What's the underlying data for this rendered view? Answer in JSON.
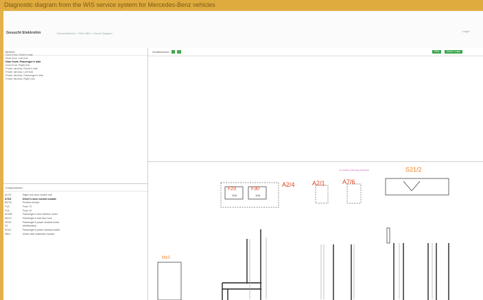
{
  "caption": "Diagnostic diagram from the WIS service system for Mercedes-Benz vehicles",
  "app": {
    "title": "Gesucht Elektrohin",
    "breadcrumb": "Internetbereich > SAK-Hilfe > Circuit Diagram",
    "login": "Login"
  },
  "sidebar": {
    "header": "Bereich",
    "items": [
      {
        "label": "Door front, Driver's side",
        "bold": false
      },
      {
        "label": "Rear door, Left rear",
        "bold": false
      },
      {
        "label": "Door front, Passenger's side",
        "bold": true
      },
      {
        "label": "Door front, Right rear",
        "bold": false
      },
      {
        "label": "Power window, Driver's side",
        "bold": false
      },
      {
        "label": "Power window, Left rear",
        "bold": false
      },
      {
        "label": "Power window, Passenger's side",
        "bold": false
      },
      {
        "label": "Power window, Right rear",
        "bold": false
      }
    ],
    "components_header": "Komponenten",
    "components": [
      {
        "code": "A17/3",
        "name": "Right rear door control unit",
        "bold": false
      },
      {
        "code": "A76/1",
        "name": "Driver's door control module",
        "bold": true
      },
      {
        "code": "B2/7A",
        "name": "Position sensor",
        "bold": false
      },
      {
        "code": "F1A",
        "name": "Fuse 73",
        "bold": false
      },
      {
        "code": "F1A",
        "name": "Fuse 10",
        "bold": false
      },
      {
        "code": "M10/B",
        "name": "Passenger's door window motor",
        "bold": false
      },
      {
        "code": "M21/1",
        "name": "Passenger's rear door lock",
        "bold": false
      },
      {
        "code": "N70/1",
        "name": "Passenger's power window motor",
        "bold": false
      },
      {
        "code": "S1",
        "name": "Multifunction",
        "bold": false
      },
      {
        "code": "S21/2",
        "name": "Passenger's power window switch",
        "bold": false
      },
      {
        "code": "W6/1",
        "name": "Driver-side switchbar module",
        "bold": false
      }
    ]
  },
  "toolbar": {
    "zoom_label": "Schaltzeichen",
    "zoom_minus": "-",
    "zoom_plus": "+",
    "btn_print": "Print",
    "btn_fullscreen": "Zoom / Lupe"
  },
  "diagram": {
    "module_label": "A2/4",
    "connector_1": "A2/1",
    "connector_2": "A7/6",
    "switch_label": "S21/2",
    "motor_label": "M10",
    "fuse_1": "F23",
    "fuse_2": "F30",
    "fuse_amp": "10A",
    "pink_note": "to control unit body element"
  }
}
